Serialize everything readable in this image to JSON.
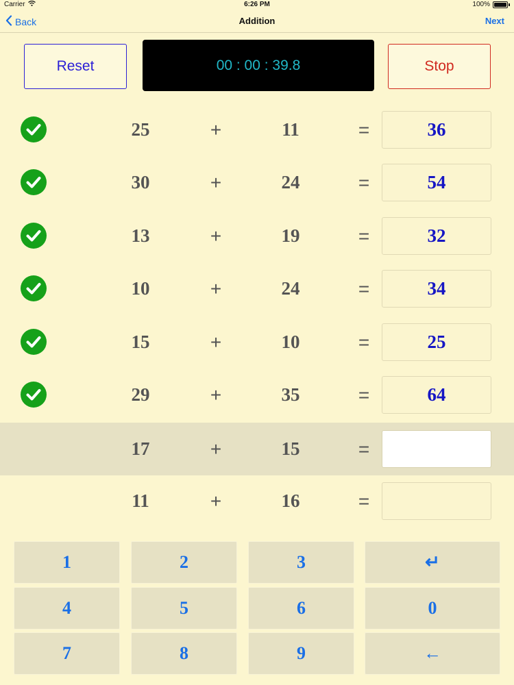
{
  "status_bar": {
    "carrier": "Carrier",
    "time": "6:26 PM",
    "battery": "100%"
  },
  "nav": {
    "back": "Back",
    "title": "Addition",
    "next": "Next"
  },
  "controls": {
    "reset": "Reset",
    "stop": "Stop",
    "timer": "00 : 00 : 39.8"
  },
  "problems": [
    {
      "a": "25",
      "op": "+",
      "b": "11",
      "eq": "=",
      "answer": "36",
      "correct": true
    },
    {
      "a": "30",
      "op": "+",
      "b": "24",
      "eq": "=",
      "answer": "54",
      "correct": true
    },
    {
      "a": "13",
      "op": "+",
      "b": "19",
      "eq": "=",
      "answer": "32",
      "correct": true
    },
    {
      "a": "10",
      "op": "+",
      "b": "24",
      "eq": "=",
      "answer": "34",
      "correct": true
    },
    {
      "a": "15",
      "op": "+",
      "b": "10",
      "eq": "=",
      "answer": "25",
      "correct": true
    },
    {
      "a": "29",
      "op": "+",
      "b": "35",
      "eq": "=",
      "answer": "64",
      "correct": true
    },
    {
      "a": "17",
      "op": "+",
      "b": "15",
      "eq": "=",
      "answer": "",
      "correct": false,
      "active": true
    },
    {
      "a": "11",
      "op": "+",
      "b": "16",
      "eq": "=",
      "answer": "",
      "correct": false
    }
  ],
  "keypad": [
    [
      "1",
      "2",
      "3",
      "↵"
    ],
    [
      "4",
      "5",
      "6",
      "0"
    ],
    [
      "7",
      "8",
      "9",
      "←"
    ]
  ],
  "colors": {
    "background": "#fcf6cf",
    "accent_blue": "#1a6fe6",
    "reset_blue": "#2b1fd6",
    "stop_red": "#d0291f",
    "timer_text": "#21b8c8",
    "check_green": "#16a11a",
    "answer_text": "#1616c4",
    "key_background": "#e6e1c4"
  },
  "icons": {
    "back": "chevron-left-icon",
    "wifi": "wifi-icon",
    "battery": "battery-icon",
    "correct": "checkmark-icon"
  }
}
